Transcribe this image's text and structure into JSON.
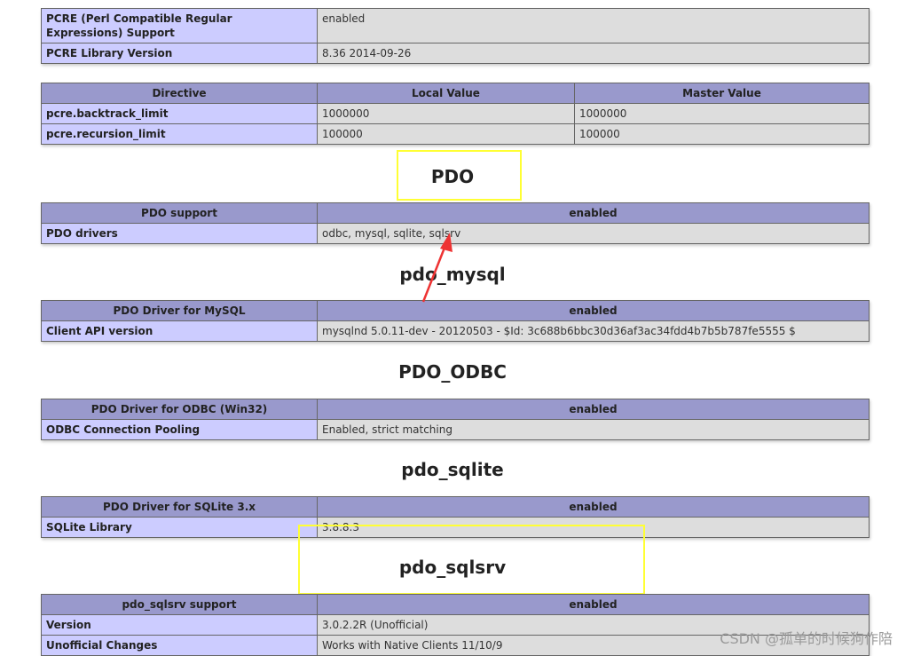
{
  "pcre": {
    "rows": [
      {
        "label": "PCRE (Perl Compatible Regular Expressions) Support",
        "value": "enabled"
      },
      {
        "label": "PCRE Library Version",
        "value": "8.36 2014-09-26"
      }
    ],
    "directives": {
      "headers": [
        "Directive",
        "Local Value",
        "Master Value"
      ],
      "rows": [
        [
          "pcre.backtrack_limit",
          "1000000",
          "1000000"
        ],
        [
          "pcre.recursion_limit",
          "100000",
          "100000"
        ]
      ]
    }
  },
  "pdo": {
    "title": "PDO",
    "header": [
      "PDO support",
      "enabled"
    ],
    "rows": [
      {
        "label": "PDO drivers",
        "value": "odbc, mysql, sqlite, sqlsrv"
      }
    ]
  },
  "pdo_mysql": {
    "title": "pdo_mysql",
    "header": [
      "PDO Driver for MySQL",
      "enabled"
    ],
    "rows": [
      {
        "label": "Client API version",
        "value": "mysqlnd 5.0.11-dev - 20120503 - $Id: 3c688b6bbc30d36af3ac34fdd4b7b5b787fe5555 $"
      }
    ]
  },
  "pdo_odbc": {
    "title": "PDO_ODBC",
    "header": [
      "PDO Driver for ODBC (Win32)",
      "enabled"
    ],
    "rows": [
      {
        "label": "ODBC Connection Pooling",
        "value": "Enabled, strict matching"
      }
    ]
  },
  "pdo_sqlite": {
    "title": "pdo_sqlite",
    "header": [
      "PDO Driver for SQLite 3.x",
      "enabled"
    ],
    "rows": [
      {
        "label": "SQLite Library",
        "value": "3.8.8.3"
      }
    ]
  },
  "pdo_sqlsrv": {
    "title": "pdo_sqlsrv",
    "header": [
      "pdo_sqlsrv support",
      "enabled"
    ],
    "rows": [
      {
        "label": "Version",
        "value": "3.0.2.2R (Unofficial)"
      },
      {
        "label": "Unofficial Changes",
        "value": "Works with Native Clients 11/10/9"
      }
    ]
  },
  "watermark": "CSDN @孤单的时候狗作陪",
  "colors": {
    "header_bg": "#9999cc",
    "label_bg": "#ccccff",
    "value_bg": "#dddddd",
    "highlight": "#ffff33",
    "arrow": "#ee3333"
  }
}
